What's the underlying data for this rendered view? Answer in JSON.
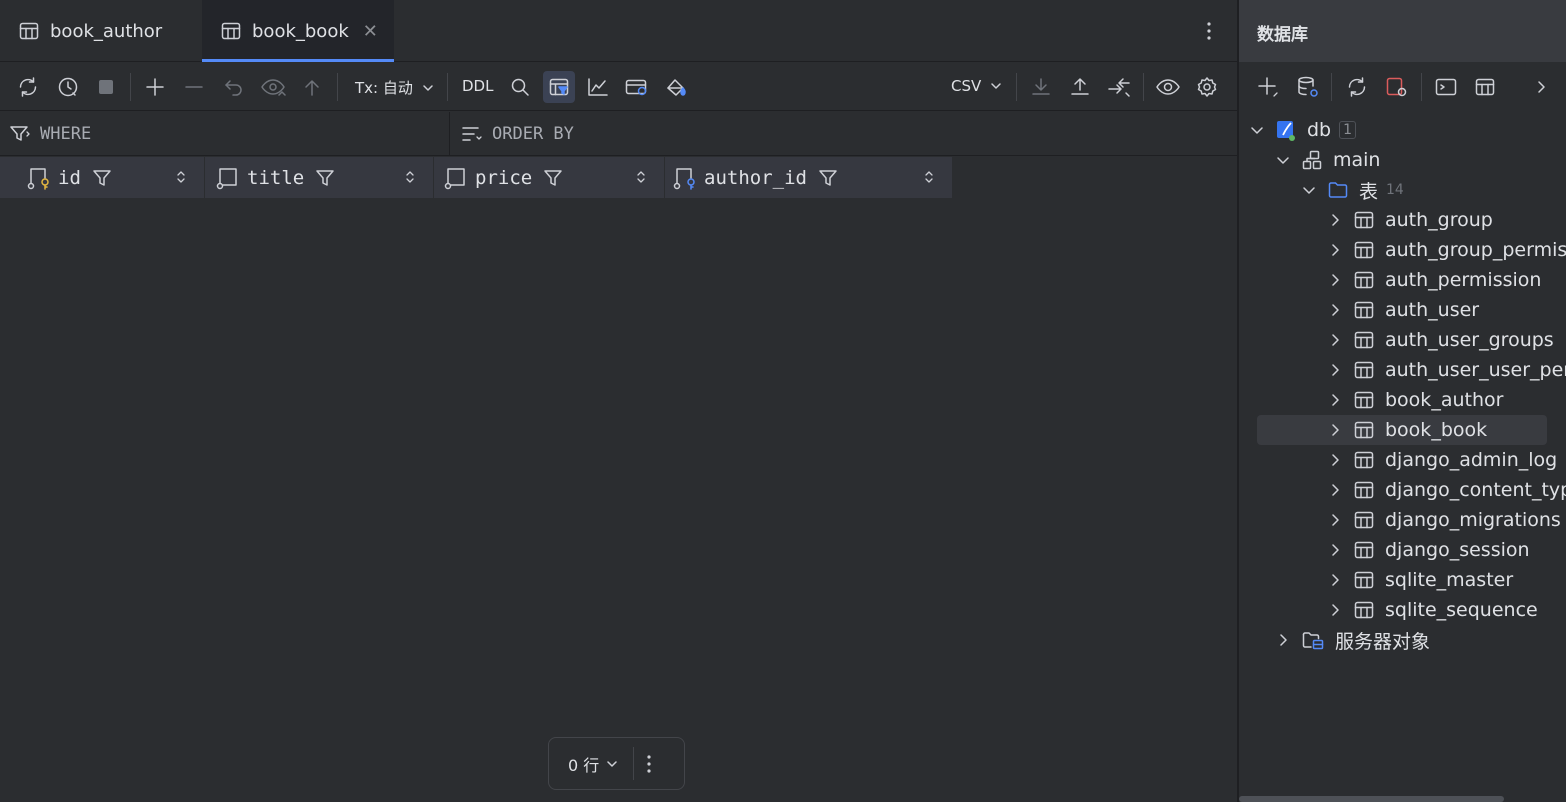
{
  "tabs": [
    {
      "label": "book_author",
      "active": false
    },
    {
      "label": "book_book",
      "active": true
    }
  ],
  "toolbar": {
    "tx_label": "Tx: 自动",
    "ddl_label": "DDL",
    "export_format": "CSV"
  },
  "filter": {
    "where_label": "WHERE",
    "orderby_label": "ORDER BY"
  },
  "columns": [
    {
      "name": "id",
      "key": "primary"
    },
    {
      "name": "title",
      "key": "none"
    },
    {
      "name": "price",
      "key": "none"
    },
    {
      "name": "author_id",
      "key": "foreign"
    }
  ],
  "pager": {
    "rows_label": "0 行"
  },
  "database_panel": {
    "title": "数据库",
    "tree": {
      "db": {
        "label": "db",
        "badge": "1"
      },
      "schema": {
        "label": "main"
      },
      "tables_folder": {
        "label": "表",
        "count": "14"
      },
      "tables": [
        "auth_group",
        "auth_group_permissions",
        "auth_permission",
        "auth_user",
        "auth_user_groups",
        "auth_user_user_permissions",
        "book_author",
        "book_book",
        "django_admin_log",
        "django_content_type",
        "django_migrations",
        "django_session",
        "sqlite_master",
        "sqlite_sequence"
      ],
      "selected_table": "book_book",
      "server_objects": {
        "label": "服务器对象"
      }
    }
  },
  "colors": {
    "accent": "#548af7",
    "background": "#2b2d30",
    "header_row": "#363840"
  }
}
